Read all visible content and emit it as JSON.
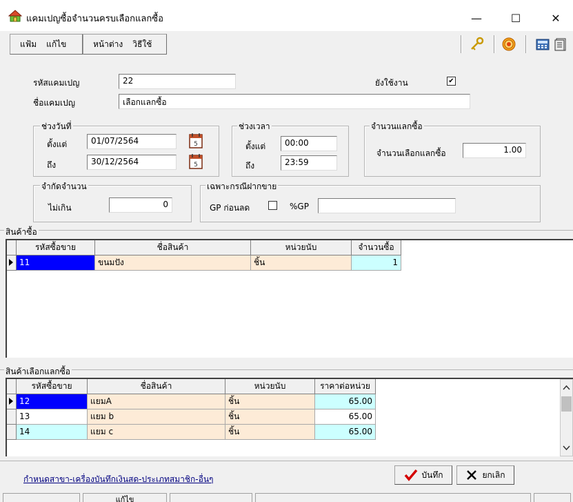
{
  "window": {
    "title": "แคมเปญซื้อจำนวนครบเลือกแลกซื้อ",
    "minimize_glyph": "—",
    "maximize_glyph": "☐",
    "close_glyph": "✕"
  },
  "menu": {
    "file": "แฟ้ม",
    "edit": "แก้ไข",
    "window": "หน้าต่าง",
    "howto": "วิธีใช้"
  },
  "toolbar_icons": [
    "key-icon",
    "target-icon",
    "calculator-icon",
    "document-icon"
  ],
  "form": {
    "campaign_code_label": "รหัสแคมเปญ",
    "campaign_code": "22",
    "campaign_name_label": "ชื่อแคมเปญ",
    "campaign_name": "เลือกแลกซื้อ",
    "active_label": "ยังใช้งาน",
    "active_checked": true,
    "check_glyph": "✔"
  },
  "date_range": {
    "title": "ช่วงวันที่",
    "from_label": "ตั้งแต่",
    "from": "01/07/2564",
    "to_label": "ถึง",
    "to": "30/12/2564"
  },
  "time_range": {
    "title": "ช่วงเวลา",
    "from_label": "ตั้งแต่",
    "from": "00:00",
    "to_label": "ถึง",
    "to": "23:59"
  },
  "redeem_qty": {
    "title": "จำนวนแลกซื้อ",
    "label": "จำนวนเลือกแลกซื้อ",
    "value": "1.00"
  },
  "limit": {
    "title": "จำกัดจำนวน",
    "label": "ไม่เกิน",
    "value": "0"
  },
  "consign": {
    "title": "เฉพาะกรณีฝากขาย",
    "gp_label": "GP ก่อนลด",
    "gp_checked": false,
    "pct_label": "%GP",
    "pct_value": ""
  },
  "buy_items": {
    "title": "สินค้าซื้อ",
    "headers": [
      "รหัสซื้อขาย",
      "ชื่อสินค้า",
      "หน่วยนับ",
      "จำนวนซื้อ"
    ],
    "rows": [
      {
        "code": "11",
        "name": "ขนมปัง",
        "unit": "ชิ้น",
        "qty": "1"
      }
    ]
  },
  "redeem_items": {
    "title": "สินค้าเลือกแลกซื้อ",
    "headers": [
      "รหัสซื้อขาย",
      "ชื่อสินค้า",
      "หน่วยนับ",
      "ราคาต่อหน่วย"
    ],
    "rows": [
      {
        "code": "12",
        "name": "แยมA",
        "unit": "ชิ้น",
        "price": "65.00"
      },
      {
        "code": "13",
        "name": "แยม b",
        "unit": "ชิ้น",
        "price": "65.00"
      },
      {
        "code": "14",
        "name": "แยม c",
        "unit": "ชิ้น",
        "price": "65.00"
      }
    ]
  },
  "footer": {
    "link": "กำหนดสาขา-เครื่องบันทึกเงินสด-ประเภทสมาชิก-อื่นๆ",
    "save": "บันทึก",
    "cancel": "ยกเลิก",
    "status_edit": "แก้ไข"
  },
  "colors": {
    "selection": "#0000ff",
    "peach": "#fdebd7",
    "cyan": "#ccffff"
  }
}
